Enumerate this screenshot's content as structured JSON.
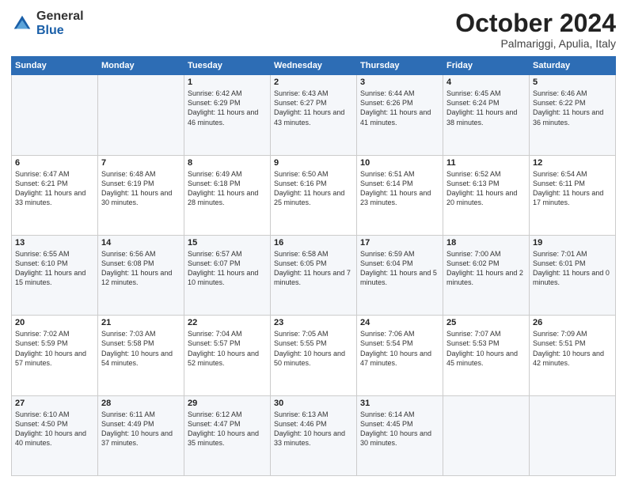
{
  "logo": {
    "general": "General",
    "blue": "Blue"
  },
  "title": "October 2024",
  "location": "Palmariggi, Apulia, Italy",
  "days_of_week": [
    "Sunday",
    "Monday",
    "Tuesday",
    "Wednesday",
    "Thursday",
    "Friday",
    "Saturday"
  ],
  "weeks": [
    [
      {
        "day": "",
        "info": ""
      },
      {
        "day": "",
        "info": ""
      },
      {
        "day": "1",
        "info": "Sunrise: 6:42 AM\nSunset: 6:29 PM\nDaylight: 11 hours and 46 minutes."
      },
      {
        "day": "2",
        "info": "Sunrise: 6:43 AM\nSunset: 6:27 PM\nDaylight: 11 hours and 43 minutes."
      },
      {
        "day": "3",
        "info": "Sunrise: 6:44 AM\nSunset: 6:26 PM\nDaylight: 11 hours and 41 minutes."
      },
      {
        "day": "4",
        "info": "Sunrise: 6:45 AM\nSunset: 6:24 PM\nDaylight: 11 hours and 38 minutes."
      },
      {
        "day": "5",
        "info": "Sunrise: 6:46 AM\nSunset: 6:22 PM\nDaylight: 11 hours and 36 minutes."
      }
    ],
    [
      {
        "day": "6",
        "info": "Sunrise: 6:47 AM\nSunset: 6:21 PM\nDaylight: 11 hours and 33 minutes."
      },
      {
        "day": "7",
        "info": "Sunrise: 6:48 AM\nSunset: 6:19 PM\nDaylight: 11 hours and 30 minutes."
      },
      {
        "day": "8",
        "info": "Sunrise: 6:49 AM\nSunset: 6:18 PM\nDaylight: 11 hours and 28 minutes."
      },
      {
        "day": "9",
        "info": "Sunrise: 6:50 AM\nSunset: 6:16 PM\nDaylight: 11 hours and 25 minutes."
      },
      {
        "day": "10",
        "info": "Sunrise: 6:51 AM\nSunset: 6:14 PM\nDaylight: 11 hours and 23 minutes."
      },
      {
        "day": "11",
        "info": "Sunrise: 6:52 AM\nSunset: 6:13 PM\nDaylight: 11 hours and 20 minutes."
      },
      {
        "day": "12",
        "info": "Sunrise: 6:54 AM\nSunset: 6:11 PM\nDaylight: 11 hours and 17 minutes."
      }
    ],
    [
      {
        "day": "13",
        "info": "Sunrise: 6:55 AM\nSunset: 6:10 PM\nDaylight: 11 hours and 15 minutes."
      },
      {
        "day": "14",
        "info": "Sunrise: 6:56 AM\nSunset: 6:08 PM\nDaylight: 11 hours and 12 minutes."
      },
      {
        "day": "15",
        "info": "Sunrise: 6:57 AM\nSunset: 6:07 PM\nDaylight: 11 hours and 10 minutes."
      },
      {
        "day": "16",
        "info": "Sunrise: 6:58 AM\nSunset: 6:05 PM\nDaylight: 11 hours and 7 minutes."
      },
      {
        "day": "17",
        "info": "Sunrise: 6:59 AM\nSunset: 6:04 PM\nDaylight: 11 hours and 5 minutes."
      },
      {
        "day": "18",
        "info": "Sunrise: 7:00 AM\nSunset: 6:02 PM\nDaylight: 11 hours and 2 minutes."
      },
      {
        "day": "19",
        "info": "Sunrise: 7:01 AM\nSunset: 6:01 PM\nDaylight: 11 hours and 0 minutes."
      }
    ],
    [
      {
        "day": "20",
        "info": "Sunrise: 7:02 AM\nSunset: 5:59 PM\nDaylight: 10 hours and 57 minutes."
      },
      {
        "day": "21",
        "info": "Sunrise: 7:03 AM\nSunset: 5:58 PM\nDaylight: 10 hours and 54 minutes."
      },
      {
        "day": "22",
        "info": "Sunrise: 7:04 AM\nSunset: 5:57 PM\nDaylight: 10 hours and 52 minutes."
      },
      {
        "day": "23",
        "info": "Sunrise: 7:05 AM\nSunset: 5:55 PM\nDaylight: 10 hours and 50 minutes."
      },
      {
        "day": "24",
        "info": "Sunrise: 7:06 AM\nSunset: 5:54 PM\nDaylight: 10 hours and 47 minutes."
      },
      {
        "day": "25",
        "info": "Sunrise: 7:07 AM\nSunset: 5:53 PM\nDaylight: 10 hours and 45 minutes."
      },
      {
        "day": "26",
        "info": "Sunrise: 7:09 AM\nSunset: 5:51 PM\nDaylight: 10 hours and 42 minutes."
      }
    ],
    [
      {
        "day": "27",
        "info": "Sunrise: 6:10 AM\nSunset: 4:50 PM\nDaylight: 10 hours and 40 minutes."
      },
      {
        "day": "28",
        "info": "Sunrise: 6:11 AM\nSunset: 4:49 PM\nDaylight: 10 hours and 37 minutes."
      },
      {
        "day": "29",
        "info": "Sunrise: 6:12 AM\nSunset: 4:47 PM\nDaylight: 10 hours and 35 minutes."
      },
      {
        "day": "30",
        "info": "Sunrise: 6:13 AM\nSunset: 4:46 PM\nDaylight: 10 hours and 33 minutes."
      },
      {
        "day": "31",
        "info": "Sunrise: 6:14 AM\nSunset: 4:45 PM\nDaylight: 10 hours and 30 minutes."
      },
      {
        "day": "",
        "info": ""
      },
      {
        "day": "",
        "info": ""
      }
    ]
  ]
}
